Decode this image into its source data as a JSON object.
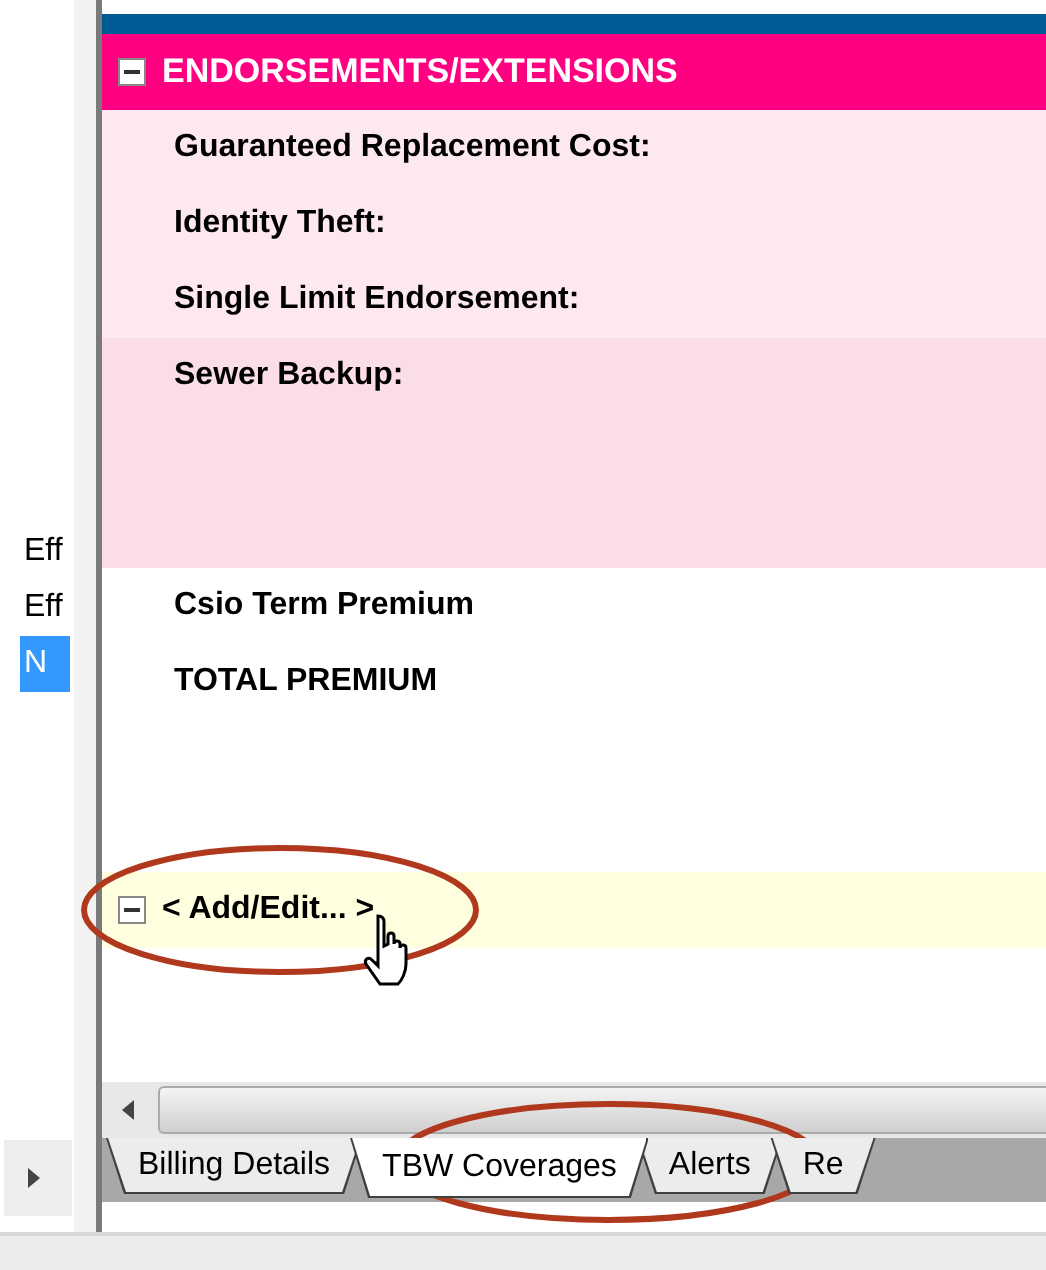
{
  "left_list": [
    {
      "label": "Eff",
      "selected": false
    },
    {
      "label": "Eff",
      "selected": false
    },
    {
      "label": "N",
      "selected": true
    }
  ],
  "section": {
    "title": "ENDORSEMENTS/EXTENSIONS",
    "expanded": true,
    "rows": [
      {
        "label": "Guaranteed Replacement Cost:",
        "kind": "light"
      },
      {
        "label": "Identity Theft:",
        "kind": "light"
      },
      {
        "label": "Single Limit Endorsement:",
        "kind": "light"
      },
      {
        "label": "Sewer Backup:",
        "kind": "shaded"
      }
    ]
  },
  "totals": [
    "Csio Term Premium",
    "TOTAL PREMIUM"
  ],
  "add_row": {
    "label": "< Add/Edit... >",
    "expanded": true
  },
  "tabs": [
    {
      "label": "Billing Details",
      "selected": false
    },
    {
      "label": "TBW Coverages",
      "selected": true
    },
    {
      "label": "Alerts",
      "selected": false
    },
    {
      "label": "Re",
      "selected": false
    }
  ]
}
